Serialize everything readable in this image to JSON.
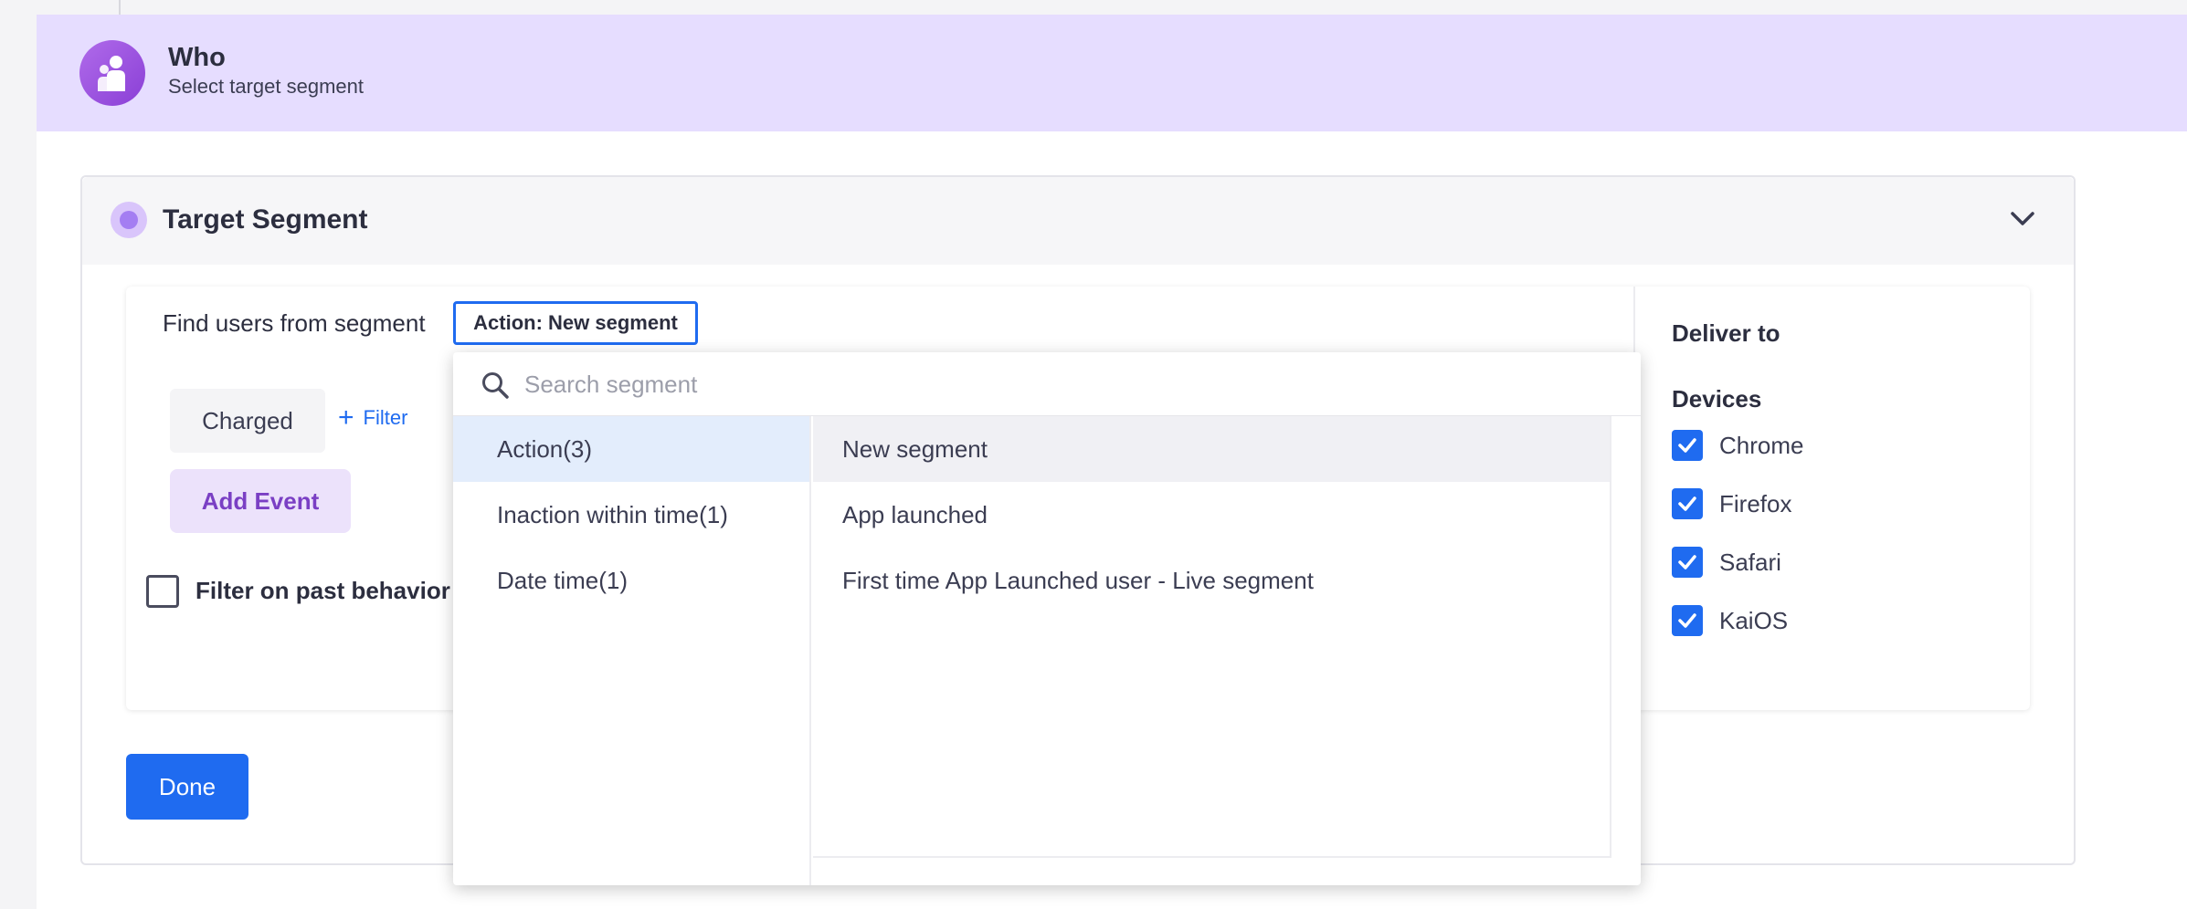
{
  "who": {
    "title": "Who",
    "subtitle": "Select target segment"
  },
  "target_segment": {
    "title": "Target Segment",
    "find_label": "Find users from segment",
    "selected_segment": "Action: New segment",
    "event_chip": "Charged",
    "filter_link": "Filter",
    "add_event": "Add Event",
    "past_behavior_label": "Filter on past behavior",
    "done": "Done"
  },
  "deliver": {
    "title": "Deliver to",
    "devices_title": "Devices",
    "devices": [
      {
        "label": "Chrome",
        "checked": true
      },
      {
        "label": "Firefox",
        "checked": true
      },
      {
        "label": "Safari",
        "checked": true
      },
      {
        "label": "KaiOS",
        "checked": true
      }
    ]
  },
  "dropdown": {
    "search_placeholder": "Search segment",
    "categories": [
      "Action(3)",
      "Inaction within time(1)",
      "Date time(1)"
    ],
    "active_category": 0,
    "segments": [
      "New segment",
      "App launched",
      "First time App Launched user - Live segment"
    ],
    "active_segment": 0
  },
  "colors": {
    "accent": "#1f6bf0",
    "banner_bg": "#e6ddff",
    "purple": "#8a3fd6"
  }
}
